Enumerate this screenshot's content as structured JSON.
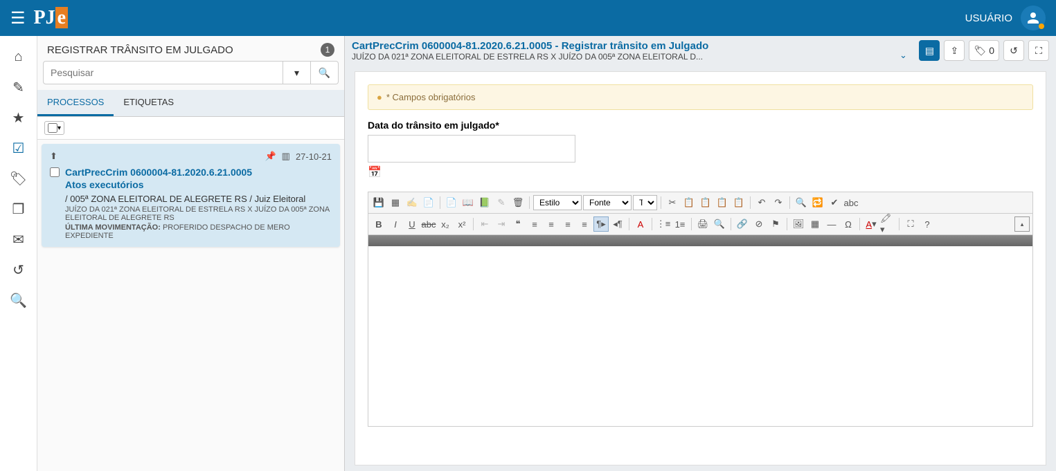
{
  "header": {
    "user_label": "USUÁRIO"
  },
  "leftPanel": {
    "title": "REGISTRAR TRÂNSITO EM JULGADO",
    "count": "1",
    "search_placeholder": "Pesquisar",
    "tabs": {
      "processos": "PROCESSOS",
      "etiquetas": "ETIQUETAS"
    }
  },
  "card": {
    "date": "27-10-21",
    "title_line1": "CartPrecCrim 0600004-81.2020.6.21.0005",
    "title_line2": "Atos executórios",
    "sub": "/ 005ª ZONA ELEITORAL DE ALEGRETE RS / Juiz Eleitoral",
    "meta1": "JUÍZO DA 021ª ZONA ELEITORAL DE ESTRELA RS X JUÍZO DA 005ª ZONA ELEITORAL DE ALEGRETE RS",
    "meta2_label": "ÚLTIMA MOVIMENTAÇÃO:",
    "meta2_value": " PROFERIDO DESPACHO DE MERO EXPEDIENTE"
  },
  "content": {
    "title": "CartPrecCrim 0600004-81.2020.6.21.0005 - Registrar trânsito em Julgado",
    "sub": "JUÍZO DA 021ª ZONA ELEITORAL DE ESTRELA RS X JUÍZO DA 005ª ZONA ELEITORAL D...",
    "tag_count": "0",
    "alert": "* Campos obrigatórios",
    "field_label": "Data do trânsito em julgado*",
    "editor": {
      "estilo": "Estilo",
      "fonte": "Fonte",
      "tamanho": "T..."
    }
  }
}
